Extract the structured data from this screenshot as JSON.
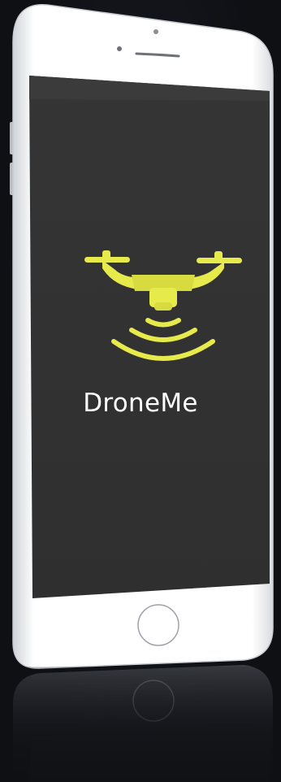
{
  "app": {
    "name": "DroneMe"
  },
  "splash": {
    "background_color": "#333333",
    "accent_color": "#e6ea4a",
    "logo_icon": "drone-signal-icon"
  },
  "device": {
    "frame_color": "#ffffff",
    "home_button": "home-button"
  }
}
